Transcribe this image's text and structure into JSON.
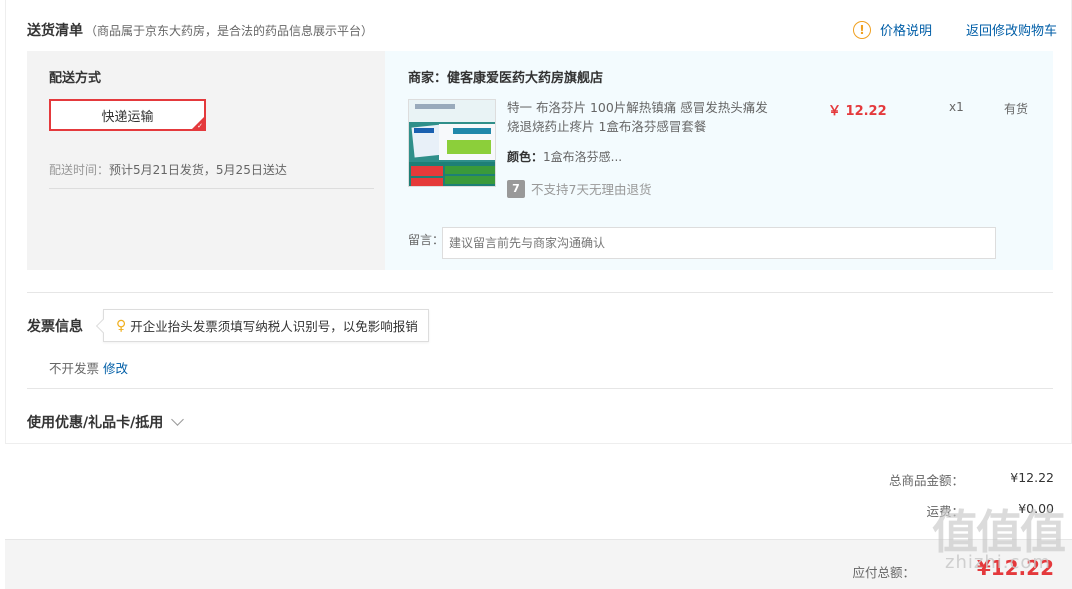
{
  "header": {
    "title": "送货清单",
    "subtitle": "（商品属于京东大药房，是合法的药品信息展示平台）",
    "price_note_label": "价格说明",
    "back_to_cart_label": "返回修改购物车"
  },
  "shipping": {
    "title": "配送方式",
    "option_label": "快递运输",
    "time_label": "配送时间：",
    "time_value": "预计5月21日发货，5月25日送达"
  },
  "shop": {
    "name_label": "商家：健客康爱医药大药房旗舰店",
    "product": {
      "title": "特一 布洛芬片 100片解热镇痛 感冒发热头痛发烧退烧药止疼片 1盒布洛芬感冒套餐",
      "price": "￥ 12.22",
      "quantity": "x1",
      "stock": "有货",
      "spec_label": "颜色：",
      "spec_value": "1盒布洛芬感...",
      "return_policy_icon": "7",
      "return_policy": "不支持7天无理由退货"
    },
    "message_label": "留言：",
    "message_placeholder": "建议留言前先与商家沟通确认"
  },
  "invoice": {
    "title": "发票信息",
    "tip": "开企业抬头发票须填写纳税人识别号，以免影响报销",
    "value": "不开发票",
    "edit_label": "修改"
  },
  "coupon": {
    "label": "使用优惠/礼品卡/抵用"
  },
  "summary": {
    "goods_total_label": "总商品金额：",
    "goods_total_value": "¥12.22",
    "shipping_fee_label": "运费：",
    "shipping_fee_value": "¥0.00",
    "payable_label": "应付总额：",
    "payable_value": "¥12.22"
  },
  "watermark": {
    "logo": "值值值",
    "text": "zhizhi.com"
  },
  "colors": {
    "accent_red": "#e4393c",
    "link_blue": "#005ea7",
    "shop_bg": "#f3fbfe"
  }
}
